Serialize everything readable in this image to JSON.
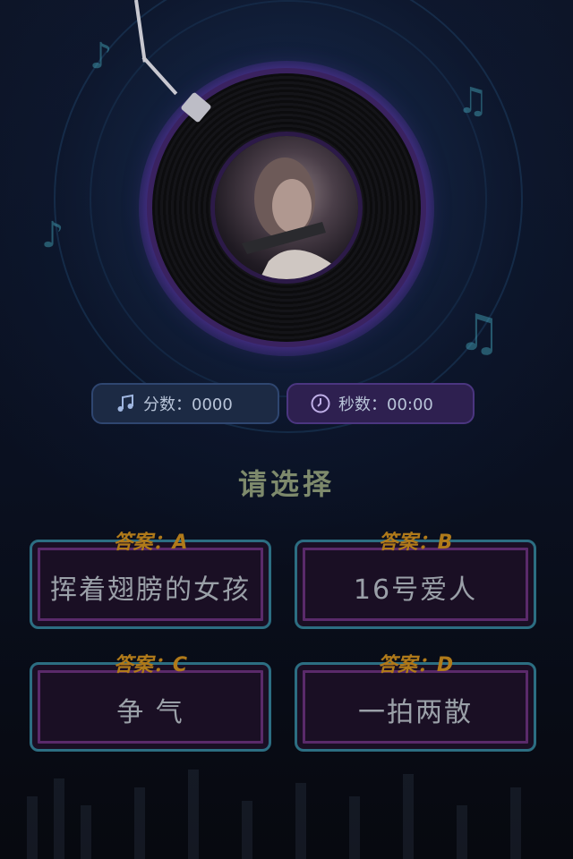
{
  "stats": {
    "score_label": "分数：0000",
    "time_label": "秒数：00:00"
  },
  "prompt": "请选择",
  "answers": [
    {
      "tag": "答案：A",
      "text": "挥着翅膀的女孩"
    },
    {
      "tag": "答案：B",
      "text": "16号爱人"
    },
    {
      "tag": "答案：C",
      "text": "争 气"
    },
    {
      "tag": "答案：D",
      "text": "一拍两散"
    }
  ],
  "colors": {
    "accent_purple": "#5a2a6a",
    "accent_teal": "#2c6e82",
    "tag_gold": "#b07a1a"
  },
  "icons": [
    "music-note-icon",
    "clock-icon",
    "album-cover",
    "tonearm"
  ]
}
